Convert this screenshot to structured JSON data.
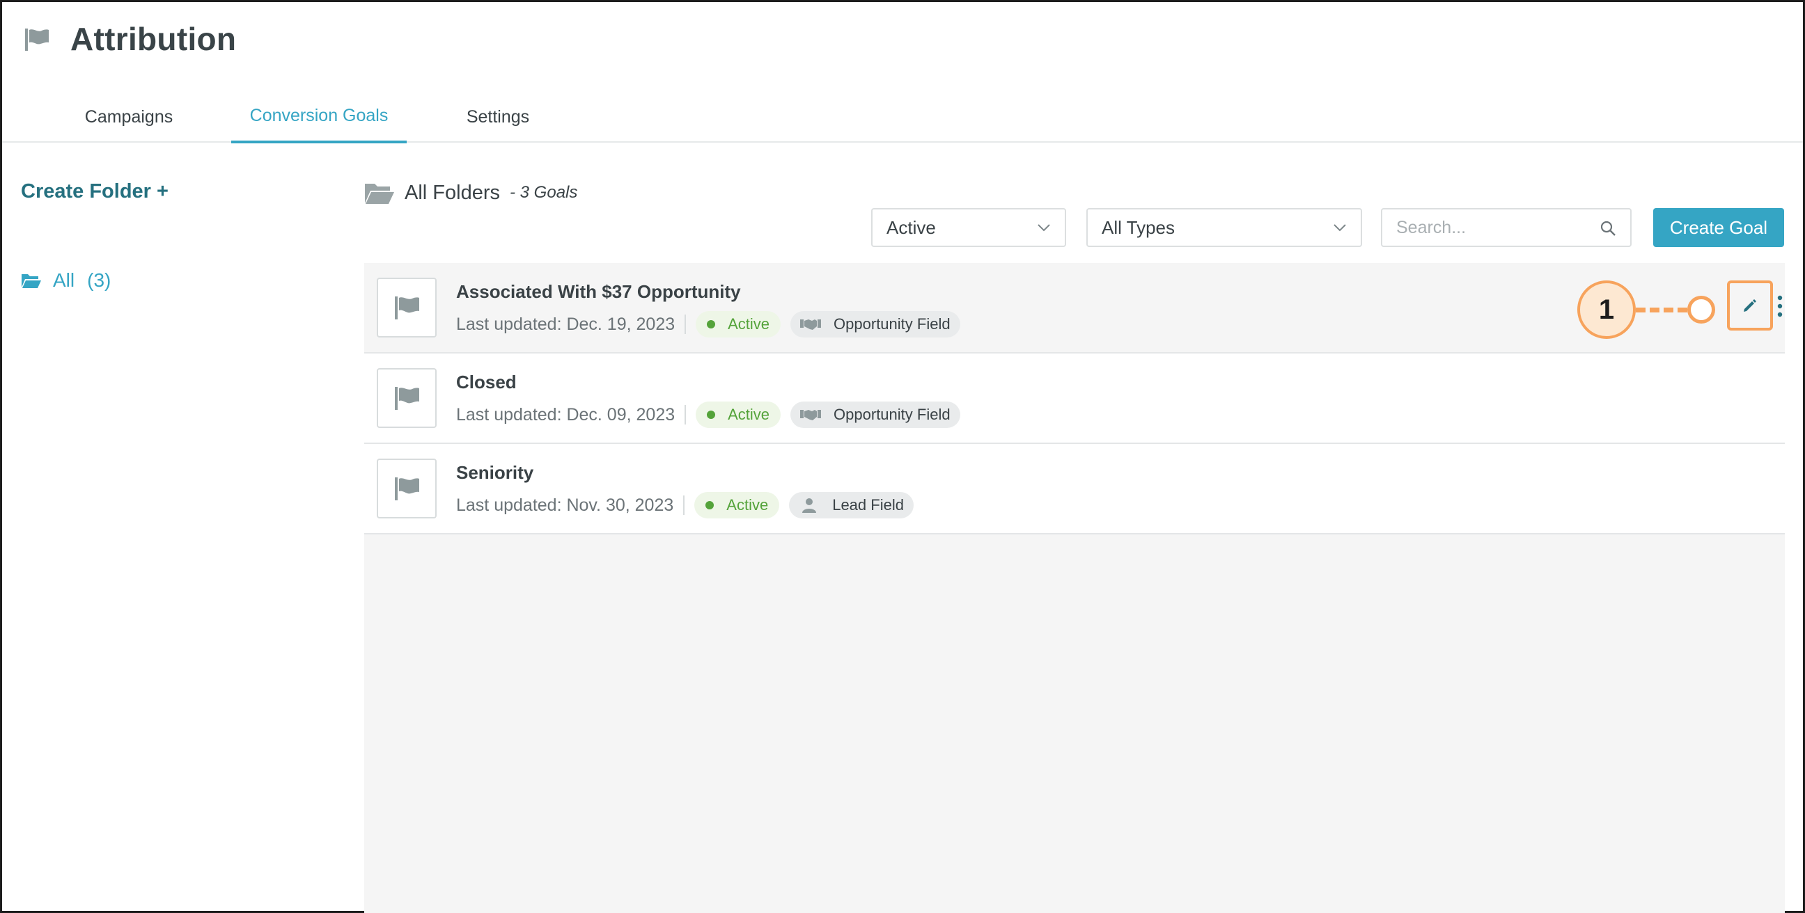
{
  "app": {
    "title": "Attribution",
    "icon": "flag-icon"
  },
  "tabs": [
    {
      "label": "Campaigns",
      "active": false
    },
    {
      "label": "Conversion Goals",
      "active": true
    },
    {
      "label": "Settings",
      "active": false
    }
  ],
  "sidebar": {
    "create_folder_label": "Create Folder +",
    "folders": [
      {
        "label": "All",
        "count": "(3)",
        "icon": "folder-open-icon"
      }
    ]
  },
  "content": {
    "folder_title": "All Folders",
    "goals_count": "- 3 Goals",
    "filters": {
      "status_value": "Active",
      "type_value": "All Types"
    },
    "search": {
      "placeholder": "Search..."
    },
    "create_goal_label": "Create Goal"
  },
  "goals": [
    {
      "name": "Associated With $37 Opportunity",
      "updated": "Last updated: Dec. 19, 2023",
      "status": "Active",
      "type": "Opportunity Field",
      "type_icon": "handshake-icon"
    },
    {
      "name": "Closed",
      "updated": "Last updated: Dec. 09, 2023",
      "status": "Active",
      "type": "Opportunity Field",
      "type_icon": "handshake-icon"
    },
    {
      "name": "Seniority",
      "updated": "Last updated: Nov. 30, 2023",
      "status": "Active",
      "type": "Lead Field",
      "type_icon": "person-icon"
    }
  ],
  "annotation": {
    "number": "1"
  },
  "colors": {
    "accent": "#35a5c4",
    "sidebar_link": "#25707f",
    "active_status": "#54a33a",
    "callout": "#f7a35c"
  }
}
